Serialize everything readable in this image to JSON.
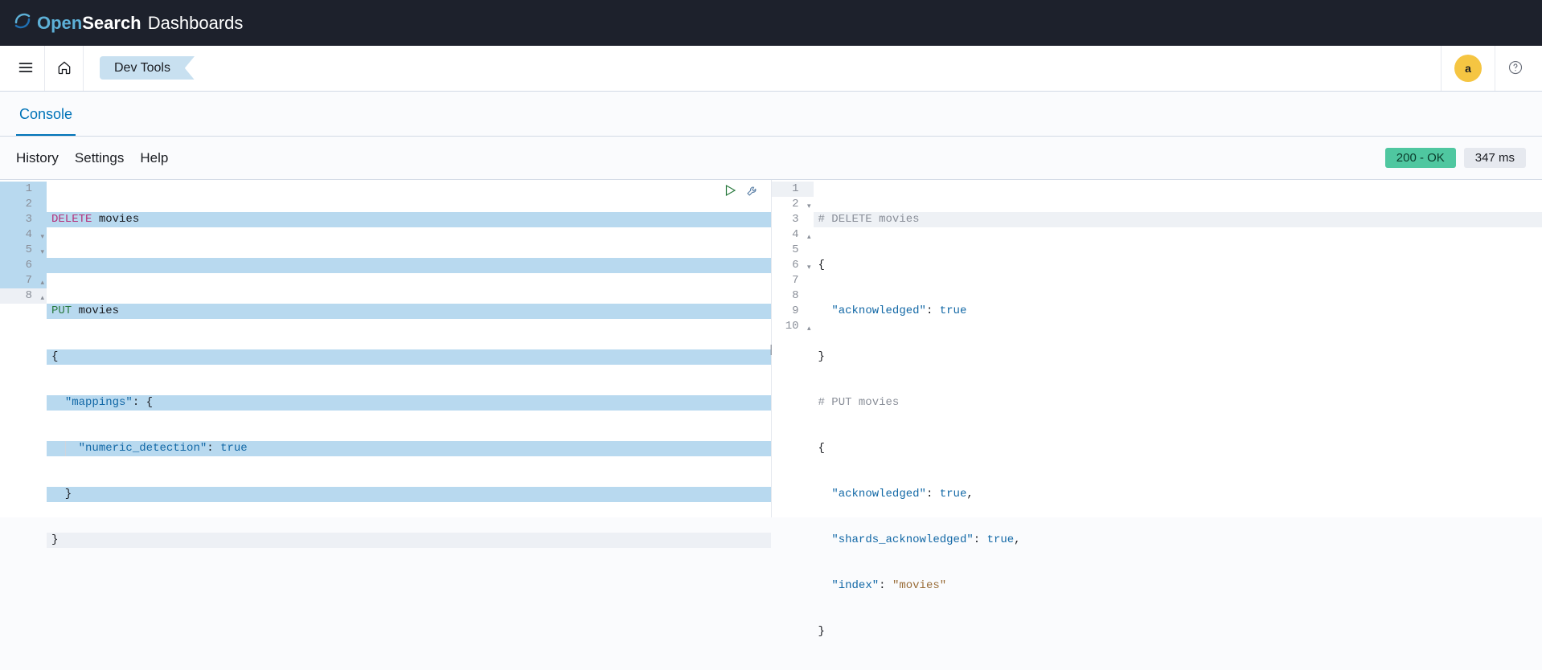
{
  "brand": {
    "open": "Open",
    "search": "Search",
    "dashboards": "Dashboards"
  },
  "breadcrumb": {
    "label": "Dev Tools"
  },
  "avatar": {
    "initial": "a"
  },
  "tabs": {
    "console": "Console"
  },
  "toolbar": {
    "history": "History",
    "settings": "Settings",
    "help": "Help"
  },
  "status": {
    "code": "200 - OK",
    "time": "347 ms"
  },
  "request": {
    "lines": [
      {
        "n": "1",
        "method": "DELETE",
        "ident": "movies"
      },
      {
        "n": "2"
      },
      {
        "n": "3",
        "method_put": "PUT",
        "ident": "movies"
      },
      {
        "n": "4",
        "fold": "▾",
        "txt": "{"
      },
      {
        "n": "5",
        "fold": "▾",
        "key": "\"mappings\"",
        "after": ": {"
      },
      {
        "n": "6",
        "key": "\"numeric_detection\"",
        "after": ": ",
        "bool": "true"
      },
      {
        "n": "7",
        "fold": "▴",
        "txt": "  }"
      },
      {
        "n": "8",
        "fold": "▴",
        "txt": "}"
      }
    ]
  },
  "response": {
    "lines": [
      {
        "n": "1",
        "comment": "# DELETE movies"
      },
      {
        "n": "2",
        "fold": "▾",
        "txt": "{"
      },
      {
        "n": "3",
        "key": "\"acknowledged\"",
        "after": ": ",
        "bool": "true"
      },
      {
        "n": "4",
        "fold": "▴",
        "txt": "}"
      },
      {
        "n": "5",
        "comment": "# PUT movies"
      },
      {
        "n": "6",
        "fold": "▾",
        "txt": "{"
      },
      {
        "n": "7",
        "key": "\"acknowledged\"",
        "after": ": ",
        "bool": "true",
        "trail": ","
      },
      {
        "n": "8",
        "key": "\"shards_acknowledged\"",
        "after": ": ",
        "bool": "true",
        "trail": ","
      },
      {
        "n": "9",
        "key": "\"index\"",
        "after": ": ",
        "str": "\"movies\""
      },
      {
        "n": "10",
        "fold": "▴",
        "txt": "}"
      }
    ]
  }
}
